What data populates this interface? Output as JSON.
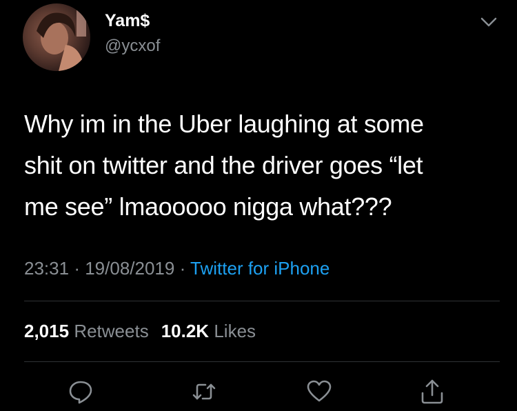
{
  "user": {
    "display_name": "Yam$",
    "handle": "@ycxof"
  },
  "tweet": {
    "lines": [
      "Why im in the Uber laughing at some",
      "shit on twitter and the driver goes “let",
      "me see” lmaooooo nigga what???"
    ],
    "time": "23:31",
    "date": "19/08/2019",
    "separator": "·",
    "source": "Twitter for iPhone"
  },
  "stats": {
    "retweets_count": "2,015",
    "retweets_label": "Retweets",
    "likes_count": "10.2K",
    "likes_label": "Likes"
  },
  "icons": {
    "menu": "chevron-down-icon",
    "reply": "reply-icon",
    "retweet": "retweet-icon",
    "like": "heart-icon",
    "share": "share-icon"
  },
  "colors": {
    "background": "#000000",
    "text": "#ffffff",
    "secondary": "#8a8f94",
    "link": "#1da1f2",
    "divider": "#2f3336"
  }
}
